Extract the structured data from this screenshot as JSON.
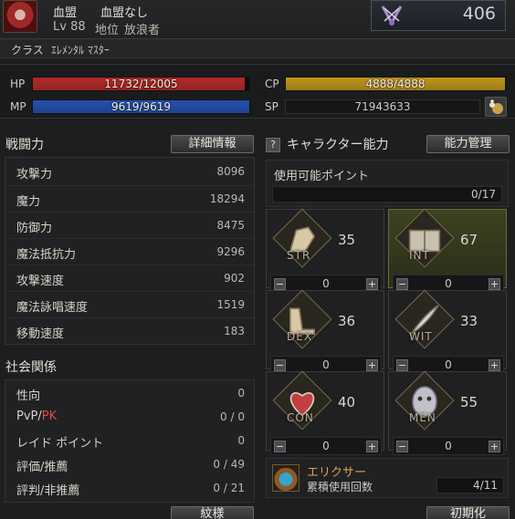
{
  "header": {
    "clan_name": "血盟",
    "clan_value": "血盟なし",
    "level": "Lv 88",
    "rank_label": "地位",
    "rank_value": "放浪者",
    "pvp_count": "406",
    "class_label": "クラス",
    "class_value": "ｴﾚﾒﾝﾀﾙ ﾏｽﾀｰ"
  },
  "stats_bars": {
    "hp_label": "HP",
    "hp_text": "11732/12005",
    "hp_fraction": 0.977,
    "hp_color": "#b32a27",
    "mp_label": "MP",
    "mp_text": "9619/9619",
    "mp_fraction": 1.0,
    "mp_color": "#2450b0",
    "cp_label": "CP",
    "cp_text": "4888/4888",
    "cp_fraction": 1.0,
    "cp_color": "#c0961c",
    "sp_label": "SP",
    "sp_text": "71943633"
  },
  "combat": {
    "title": "戦闘力",
    "detail_button": "詳細情報",
    "rows": [
      {
        "name": "攻撃力",
        "value": "8096"
      },
      {
        "name": "魔力",
        "value": "18294"
      },
      {
        "name": "防御力",
        "value": "8475"
      },
      {
        "name": "魔法抵抗力",
        "value": "9296"
      },
      {
        "name": "攻撃速度",
        "value": "902"
      },
      {
        "name": "魔法詠唱速度",
        "value": "1519"
      },
      {
        "name": "移動速度",
        "value": "183"
      }
    ]
  },
  "social": {
    "title": "社会関係",
    "rows": [
      {
        "name": "性向",
        "value": "0"
      },
      {
        "name_a": "PvP/",
        "name_b": "PK",
        "value": "0 / 0"
      },
      {
        "name": "レイド ポイント",
        "value": "0"
      },
      {
        "name": "評価/推薦",
        "value": "0 / 49"
      },
      {
        "name": "評判/非推薦",
        "value": "0 / 21"
      }
    ],
    "bottom_button": "紋様"
  },
  "abilities": {
    "help_icon": "?",
    "title": "キャラクター能力",
    "manage_button": "能力管理",
    "points_label": "使用可能ポイント",
    "points_value": "0/17",
    "attrs": [
      {
        "name": "STR",
        "value": "35",
        "alloc": "0"
      },
      {
        "name": "INT",
        "value": "67",
        "alloc": "0"
      },
      {
        "name": "DEX",
        "value": "36",
        "alloc": "0"
      },
      {
        "name": "WIT",
        "value": "33",
        "alloc": "0"
      },
      {
        "name": "CON",
        "value": "40",
        "alloc": "0"
      },
      {
        "name": "MEN",
        "value": "55",
        "alloc": "0"
      }
    ],
    "minus": "−",
    "plus": "+",
    "elixir_title": "エリクサー",
    "elixir_label": "累積使用回数",
    "elixir_value": "4/11",
    "reset_button": "初期化"
  }
}
